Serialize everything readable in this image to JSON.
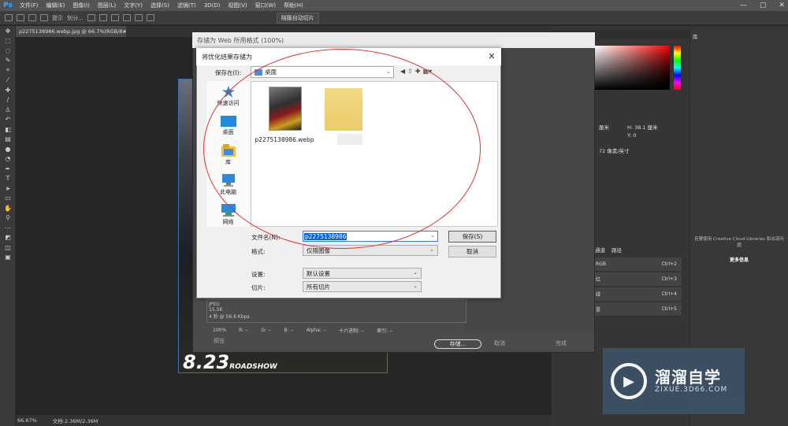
{
  "app": {
    "logo": "Ps",
    "menu": [
      "文件(F)",
      "编辑(E)",
      "图像(I)",
      "图层(L)",
      "文字(Y)",
      "选择(S)",
      "滤镜(T)",
      "3D(D)",
      "视图(V)",
      "窗口(W)",
      "帮助(H)"
    ],
    "window_controls": [
      "—",
      "▢",
      "✕"
    ],
    "options_bar": {
      "opt1": "提示",
      "opt2": "划分...",
      "batch_slice": "陪履自动切片"
    }
  },
  "document": {
    "tab": "p2275138986.webp.jpg @ 66.7%(RGB/8#) *",
    "status_zoom": "66.67%",
    "status_doc": "文档:2.36M/2.36M",
    "image_text": "8.23",
    "image_subtext": "ROADSHOW"
  },
  "save_for_web": {
    "title": "存储为 Web 所用格式 (100%)",
    "save_button": "存储...",
    "cancel_button": "取消",
    "done_button": "完成",
    "preview_button": "预览",
    "toolstrip": [
      "100%",
      "R: --",
      "G: --",
      "B: --",
      "Alpha: --",
      "十六进制: --",
      "索引: --"
    ],
    "bottom_info": [
      "JPEG",
      "15.5K",
      "4 秒 @ 56.6 Kbps"
    ]
  },
  "save_dialog": {
    "title": "将优化结果存储为",
    "save_in_label": "保存在(I):",
    "save_in_value": "桌面",
    "places": [
      {
        "label": "快速访问",
        "icon": "star-icon"
      },
      {
        "label": "桌面",
        "icon": "desktop-icon"
      },
      {
        "label": "库",
        "icon": "library-icon"
      },
      {
        "label": "此电脑",
        "icon": "computer-icon"
      },
      {
        "label": "网络",
        "icon": "network-icon"
      }
    ],
    "files": [
      {
        "name": "p2275138986.webp"
      }
    ],
    "filename_label": "文件名(N):",
    "filename_value": "p2275138986",
    "format_label": "格式:",
    "format_value": "仅限图像",
    "settings_label": "设置:",
    "settings_value": "默认设置",
    "slices_label": "切片:",
    "slices_value": "所有切片",
    "save_button": "保存(S)",
    "cancel_button": "取消"
  },
  "right_panels": {
    "library_tab": "库",
    "cc_text": "若要使用 Creative Cloud Libraries 和出现问题",
    "cc_more": "更多信息",
    "properties": {
      "w": "厘米",
      "h": "H: 38.1 厘米",
      "x": "X: 0",
      "y": "Y: 0",
      "res": "72 像素/英寸"
    },
    "channels_tab": "通道",
    "paths_tab": "路径",
    "channels": [
      {
        "name": "RGB",
        "shortcut": "Ctrl+2"
      },
      {
        "name": "红",
        "shortcut": "Ctrl+3"
      },
      {
        "name": "绿",
        "shortcut": "Ctrl+4"
      },
      {
        "name": "蓝",
        "shortcut": "Ctrl+5"
      }
    ]
  },
  "watermark": {
    "title": "溜溜自学",
    "url": "ZIXUE.3D66.COM"
  },
  "colors": {
    "accent": "#0078d7",
    "annotation": "#d93333"
  }
}
